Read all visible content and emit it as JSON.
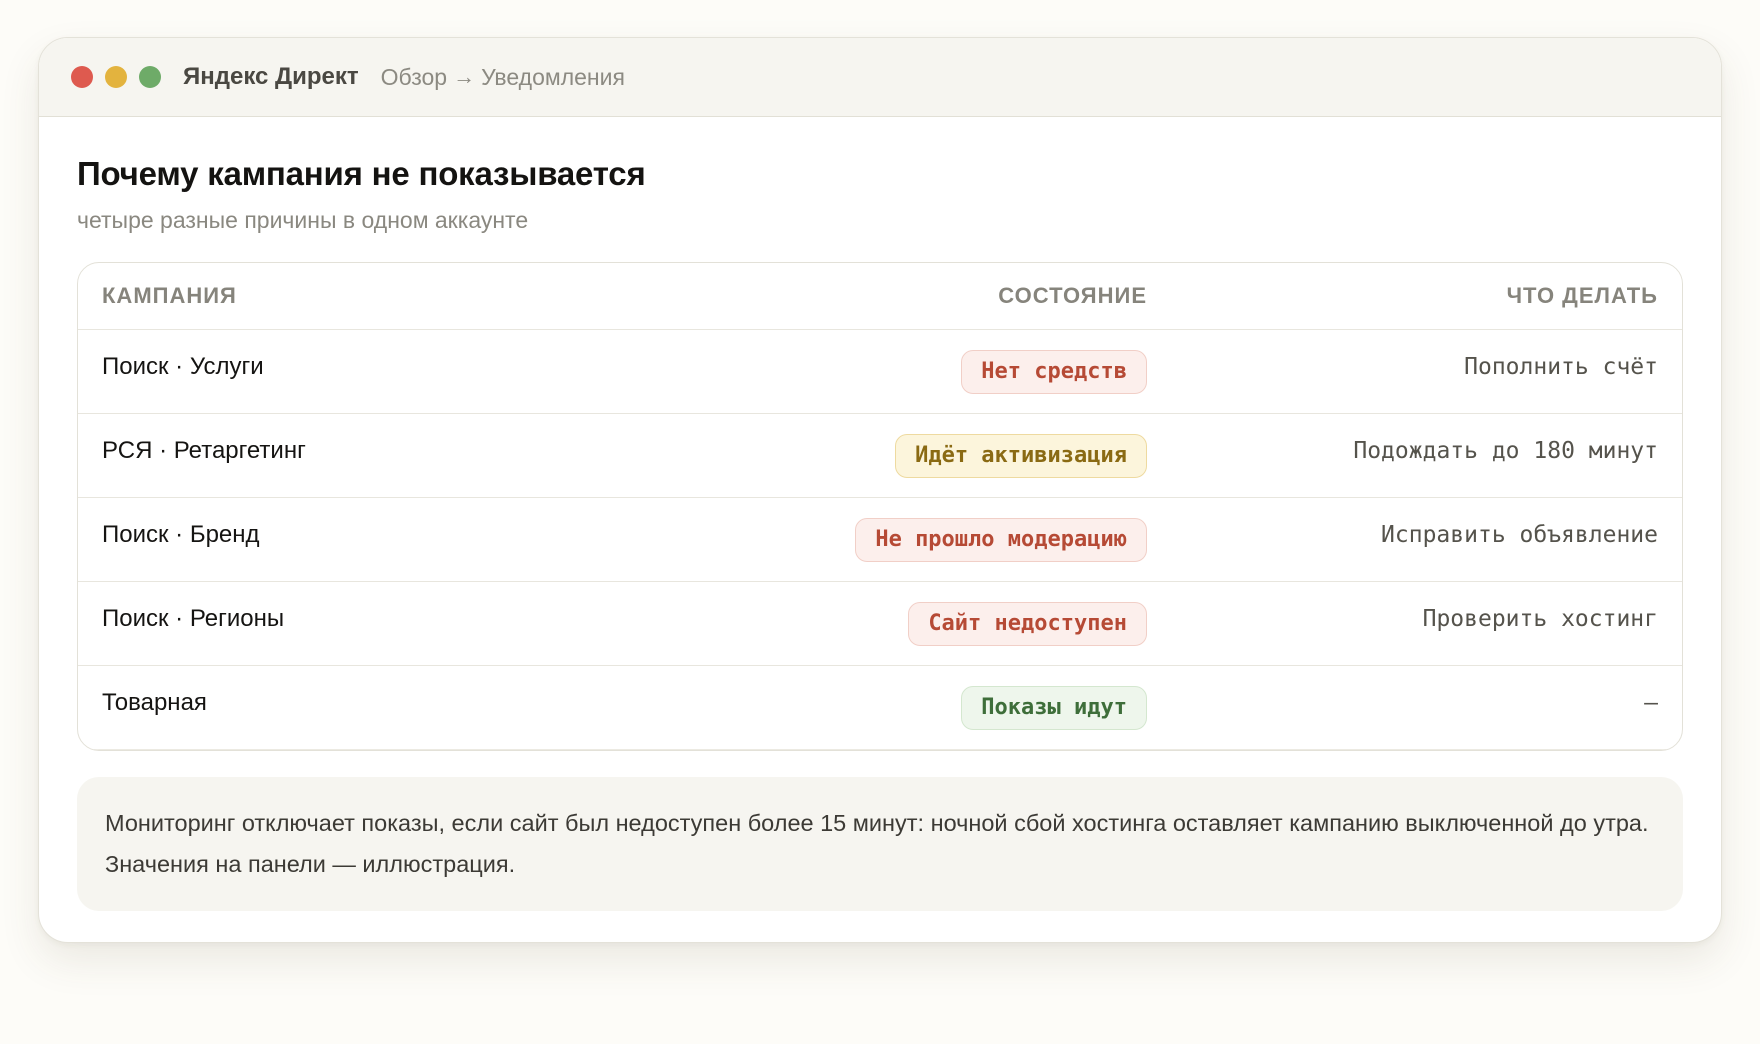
{
  "window": {
    "app_name": "Яндекс Директ",
    "breadcrumb": [
      "Обзор",
      "Уведомления"
    ],
    "breadcrumb_separator": "→"
  },
  "page": {
    "title": "Почему кампания не показывается",
    "subtitle": "четыре разные причины в одном аккаунте"
  },
  "table": {
    "columns": [
      "Кампания",
      "Состояние",
      "Что делать"
    ],
    "rows": [
      {
        "campaign": "Поиск · Услуги",
        "status": "Нет средств",
        "status_tone": "red",
        "action": "Пополнить счёт"
      },
      {
        "campaign": "РСЯ · Ретаргетинг",
        "status": "Идёт активизация",
        "status_tone": "yellow",
        "action": "Подождать до 180 минут"
      },
      {
        "campaign": "Поиск · Бренд",
        "status": "Не прошло модерацию",
        "status_tone": "red",
        "action": "Исправить объявление"
      },
      {
        "campaign": "Поиск · Регионы",
        "status": "Сайт недоступен",
        "status_tone": "red",
        "action": "Проверить хостинг"
      },
      {
        "campaign": "Товарная",
        "status": "Показы идут",
        "status_tone": "green",
        "action": "—"
      }
    ]
  },
  "note": "Мониторинг отключает показы, если сайт был недоступен более 15 минут: ночной сбой хостинга оставляет кампанию выключенной до утра. Значения на панели — иллюстрация.",
  "colors": {
    "dot_red": "#de5a4f",
    "dot_yellow": "#e3b33e",
    "dot_green": "#6eab68",
    "badge_red_text": "#b64a35",
    "badge_yellow_text": "#8a6a13",
    "badge_green_text": "#3e6e3a"
  }
}
